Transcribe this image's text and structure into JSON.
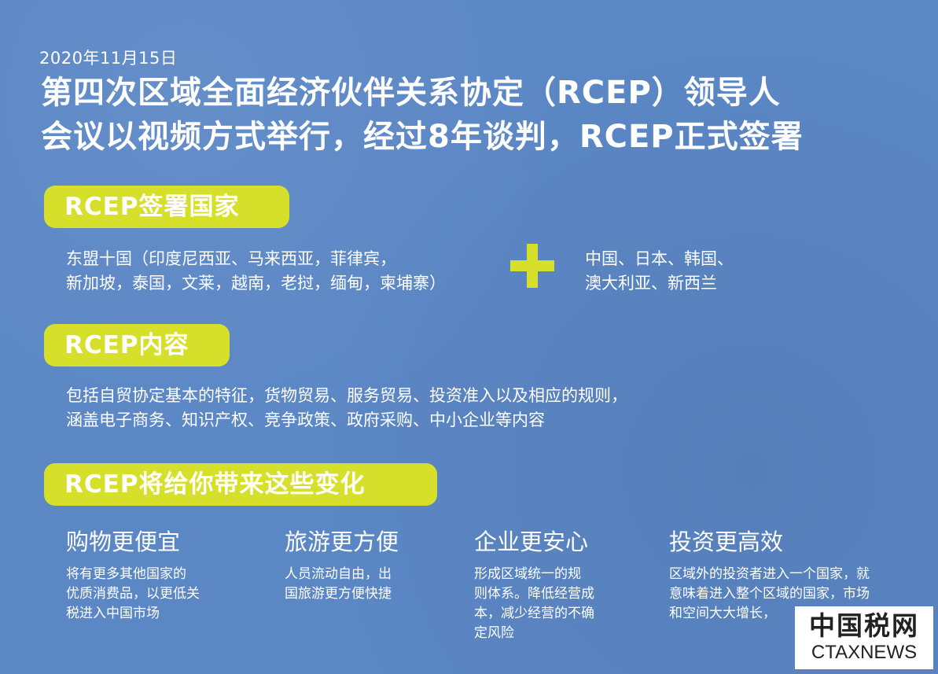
{
  "date": "2020年11月15日",
  "headline": {
    "line1": "第四次区域全面经济伙伴关系协定（RCEP）领导人",
    "line2": "会议以视频方式举行，经过8年谈判，RCEP正式签署"
  },
  "members": {
    "pill": "RCEP签署国家",
    "asean_line1": "东盟十国（印度尼西亚、马来西亚，菲律宾，",
    "asean_line2": "新加坡，泰国，文莱，越南，老挝，缅甸，柬埔寨）",
    "plus_icon": "plus-icon",
    "others_line1": "中国、日本、韩国、",
    "others_line2": "澳大利亚、新西兰"
  },
  "content": {
    "pill": "RCEP内容",
    "line1": "包括自贸协定基本的特征，货物贸易、服务贸易、投资准入以及相应的规则，",
    "line2": "涵盖电子商务、知识产权、竞争政策、政府采购、中小企业等内容"
  },
  "changes": {
    "pill": "RCEP将给你带来这些变化",
    "items": [
      {
        "title": "购物更便宜",
        "desc_lines": [
          "将有更多其他国家的",
          "优质消费品，以更低关",
          "税进入中国市场"
        ]
      },
      {
        "title": "旅游更方便",
        "desc_lines": [
          "人员流动自由，出",
          "国旅游更方便快捷"
        ]
      },
      {
        "title": "企业更安心",
        "desc_lines": [
          "形成区域统一的规",
          "则体系。降低经营成",
          "本，减少经营的不确",
          "定风险"
        ]
      },
      {
        "title": "投资更高效",
        "desc_lines": [
          "区域外的投资者进入一个国家，就",
          "意味着进入整个区域的国家，市场",
          "和空间大大增长，"
        ]
      }
    ]
  },
  "watermark": {
    "cn": "中国税网",
    "en": "CTAXNEWS"
  },
  "colors": {
    "background": "#5b87c5",
    "accent": "#d6e02a",
    "text": "#ffffff"
  }
}
